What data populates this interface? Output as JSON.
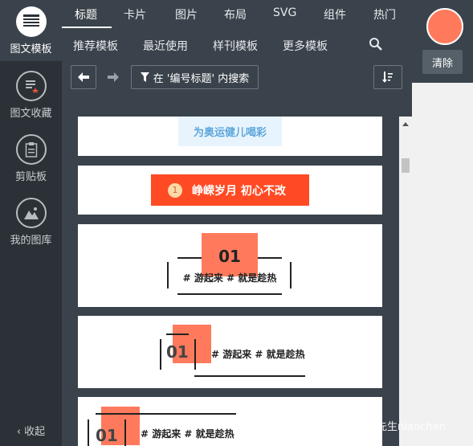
{
  "sidebar": {
    "items": [
      {
        "label": "图文模板",
        "icon": "template-icon"
      },
      {
        "label": "图文收藏",
        "icon": "favorites-icon"
      },
      {
        "label": "剪贴板",
        "icon": "clipboard-icon"
      },
      {
        "label": "我的图库",
        "icon": "gallery-icon"
      }
    ],
    "collapse_label": "收起"
  },
  "top_tabs": [
    "标题",
    "卡片",
    "图片",
    "布局",
    "SVG",
    "组件",
    "热门"
  ],
  "sub_tabs": [
    "推荐模板",
    "最近使用",
    "样刊模板",
    "更多模板"
  ],
  "toolbar": {
    "search_in_label": "在 '编号标题' 内搜索"
  },
  "cards": {
    "card1_text": "为奥运健儿喝彩",
    "card2_num": "1",
    "card2_text": "峥嵘岁月 初心不改",
    "card3_num": "01",
    "card3_text": "# 游起来 # 就是趁热",
    "card4_num": "01",
    "card4_text": "# 游起来 # 就是趁热",
    "card5_num": "01",
    "card5_text": "# 游起来 # 就是趁热"
  },
  "right": {
    "clear_label": "清除"
  },
  "watermark": "念尘先生nianchen",
  "colors": {
    "accent": "#ff7a5c",
    "title_red": "#ff4a24",
    "light_blue": "#e8f4fd",
    "sidebar_bg": "#2b3136",
    "panel_bg": "#3a434b"
  }
}
